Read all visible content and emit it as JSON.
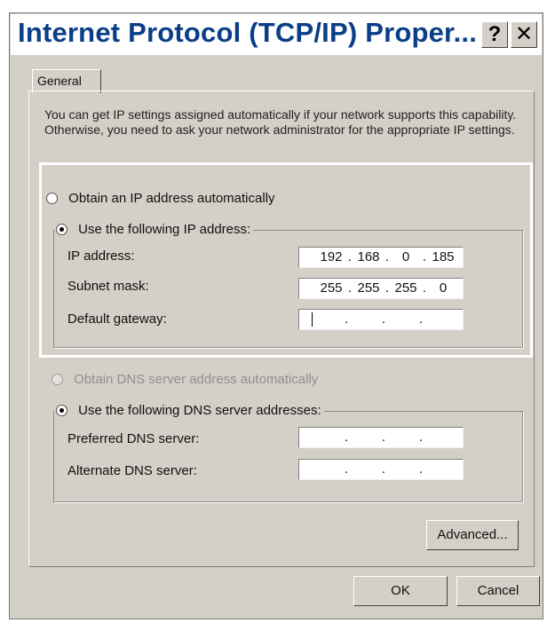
{
  "window": {
    "title": "Internet Protocol (TCP/IP) Proper...",
    "help_label": "?",
    "close_label": "✕"
  },
  "tabs": [
    {
      "label": "General"
    }
  ],
  "intro_text": "You can get IP settings assigned automatically if your network supports this capability. Otherwise, you need to ask your network administrator for the appropriate IP settings.",
  "ip_settings": {
    "obtain_auto_label": "Obtain an IP address automatically",
    "use_following_label": "Use the following IP address:",
    "fields": [
      {
        "label": "IP address:",
        "octets": [
          "192",
          "168",
          "0",
          "185"
        ]
      },
      {
        "label": "Subnet mask:",
        "octets": [
          "255",
          "255",
          "255",
          "0"
        ]
      },
      {
        "label": "Default gateway:",
        "octets": [
          "",
          "",
          "",
          ""
        ]
      }
    ]
  },
  "dns_settings": {
    "obtain_auto_label": "Obtain DNS server address automatically",
    "use_following_label": "Use the following DNS server addresses:",
    "fields": [
      {
        "label": "Preferred DNS server:",
        "octets": [
          "",
          "",
          "",
          ""
        ]
      },
      {
        "label": "Alternate DNS server:",
        "octets": [
          "",
          "",
          "",
          ""
        ]
      }
    ]
  },
  "buttons": {
    "advanced": "Advanced...",
    "ok": "OK",
    "cancel": "Cancel"
  },
  "colors": {
    "dialog_bg": "#d4d0c8",
    "title_text": "#0a3f87",
    "highlight_border": "#ffffff"
  }
}
